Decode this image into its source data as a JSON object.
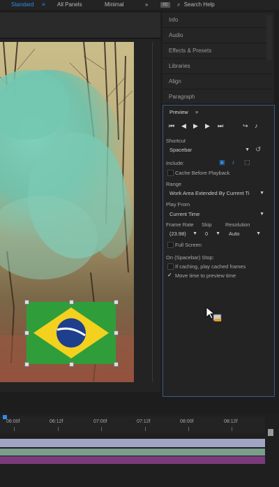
{
  "workspace": {
    "standard": "Standard",
    "menu_icon": "≡",
    "all_panels": "All Panels",
    "minimal": "Minimal",
    "more": "»",
    "badge": "CC",
    "search": "Search Help"
  },
  "panels": {
    "items": [
      "Info",
      "Audio",
      "Effects & Presets",
      "Libraries",
      "Align",
      "Paragraph"
    ]
  },
  "preview": {
    "title": "Preview",
    "menu_icon": "≡",
    "shortcut_label": "Shortcut",
    "shortcut_value": "Spacebar",
    "include_label": "Include:",
    "cache_before_playback": "Cache Before Playback",
    "range_label": "Range",
    "range_value": "Work Area Extended By Current Ti",
    "play_from_label": "Play From",
    "play_from_value": "Current Time",
    "frame_rate_label": "Frame Rate",
    "skip_label": "Skip",
    "resolution_label": "Resolution",
    "frame_rate_value": "(23.98)",
    "skip_value": "0",
    "resolution_value": "Auto",
    "full_screen": "Full Screen",
    "on_stop_label": "On (Spacebar) Stop:",
    "if_caching": "If caching, play cached frames",
    "move_time": "Move time to preview time",
    "move_time_checked": true
  },
  "timeline": {
    "ticks": [
      "06:00f",
      "06:12f",
      "07:00f",
      "07:12f",
      "08:00f",
      "08:12f"
    ]
  }
}
